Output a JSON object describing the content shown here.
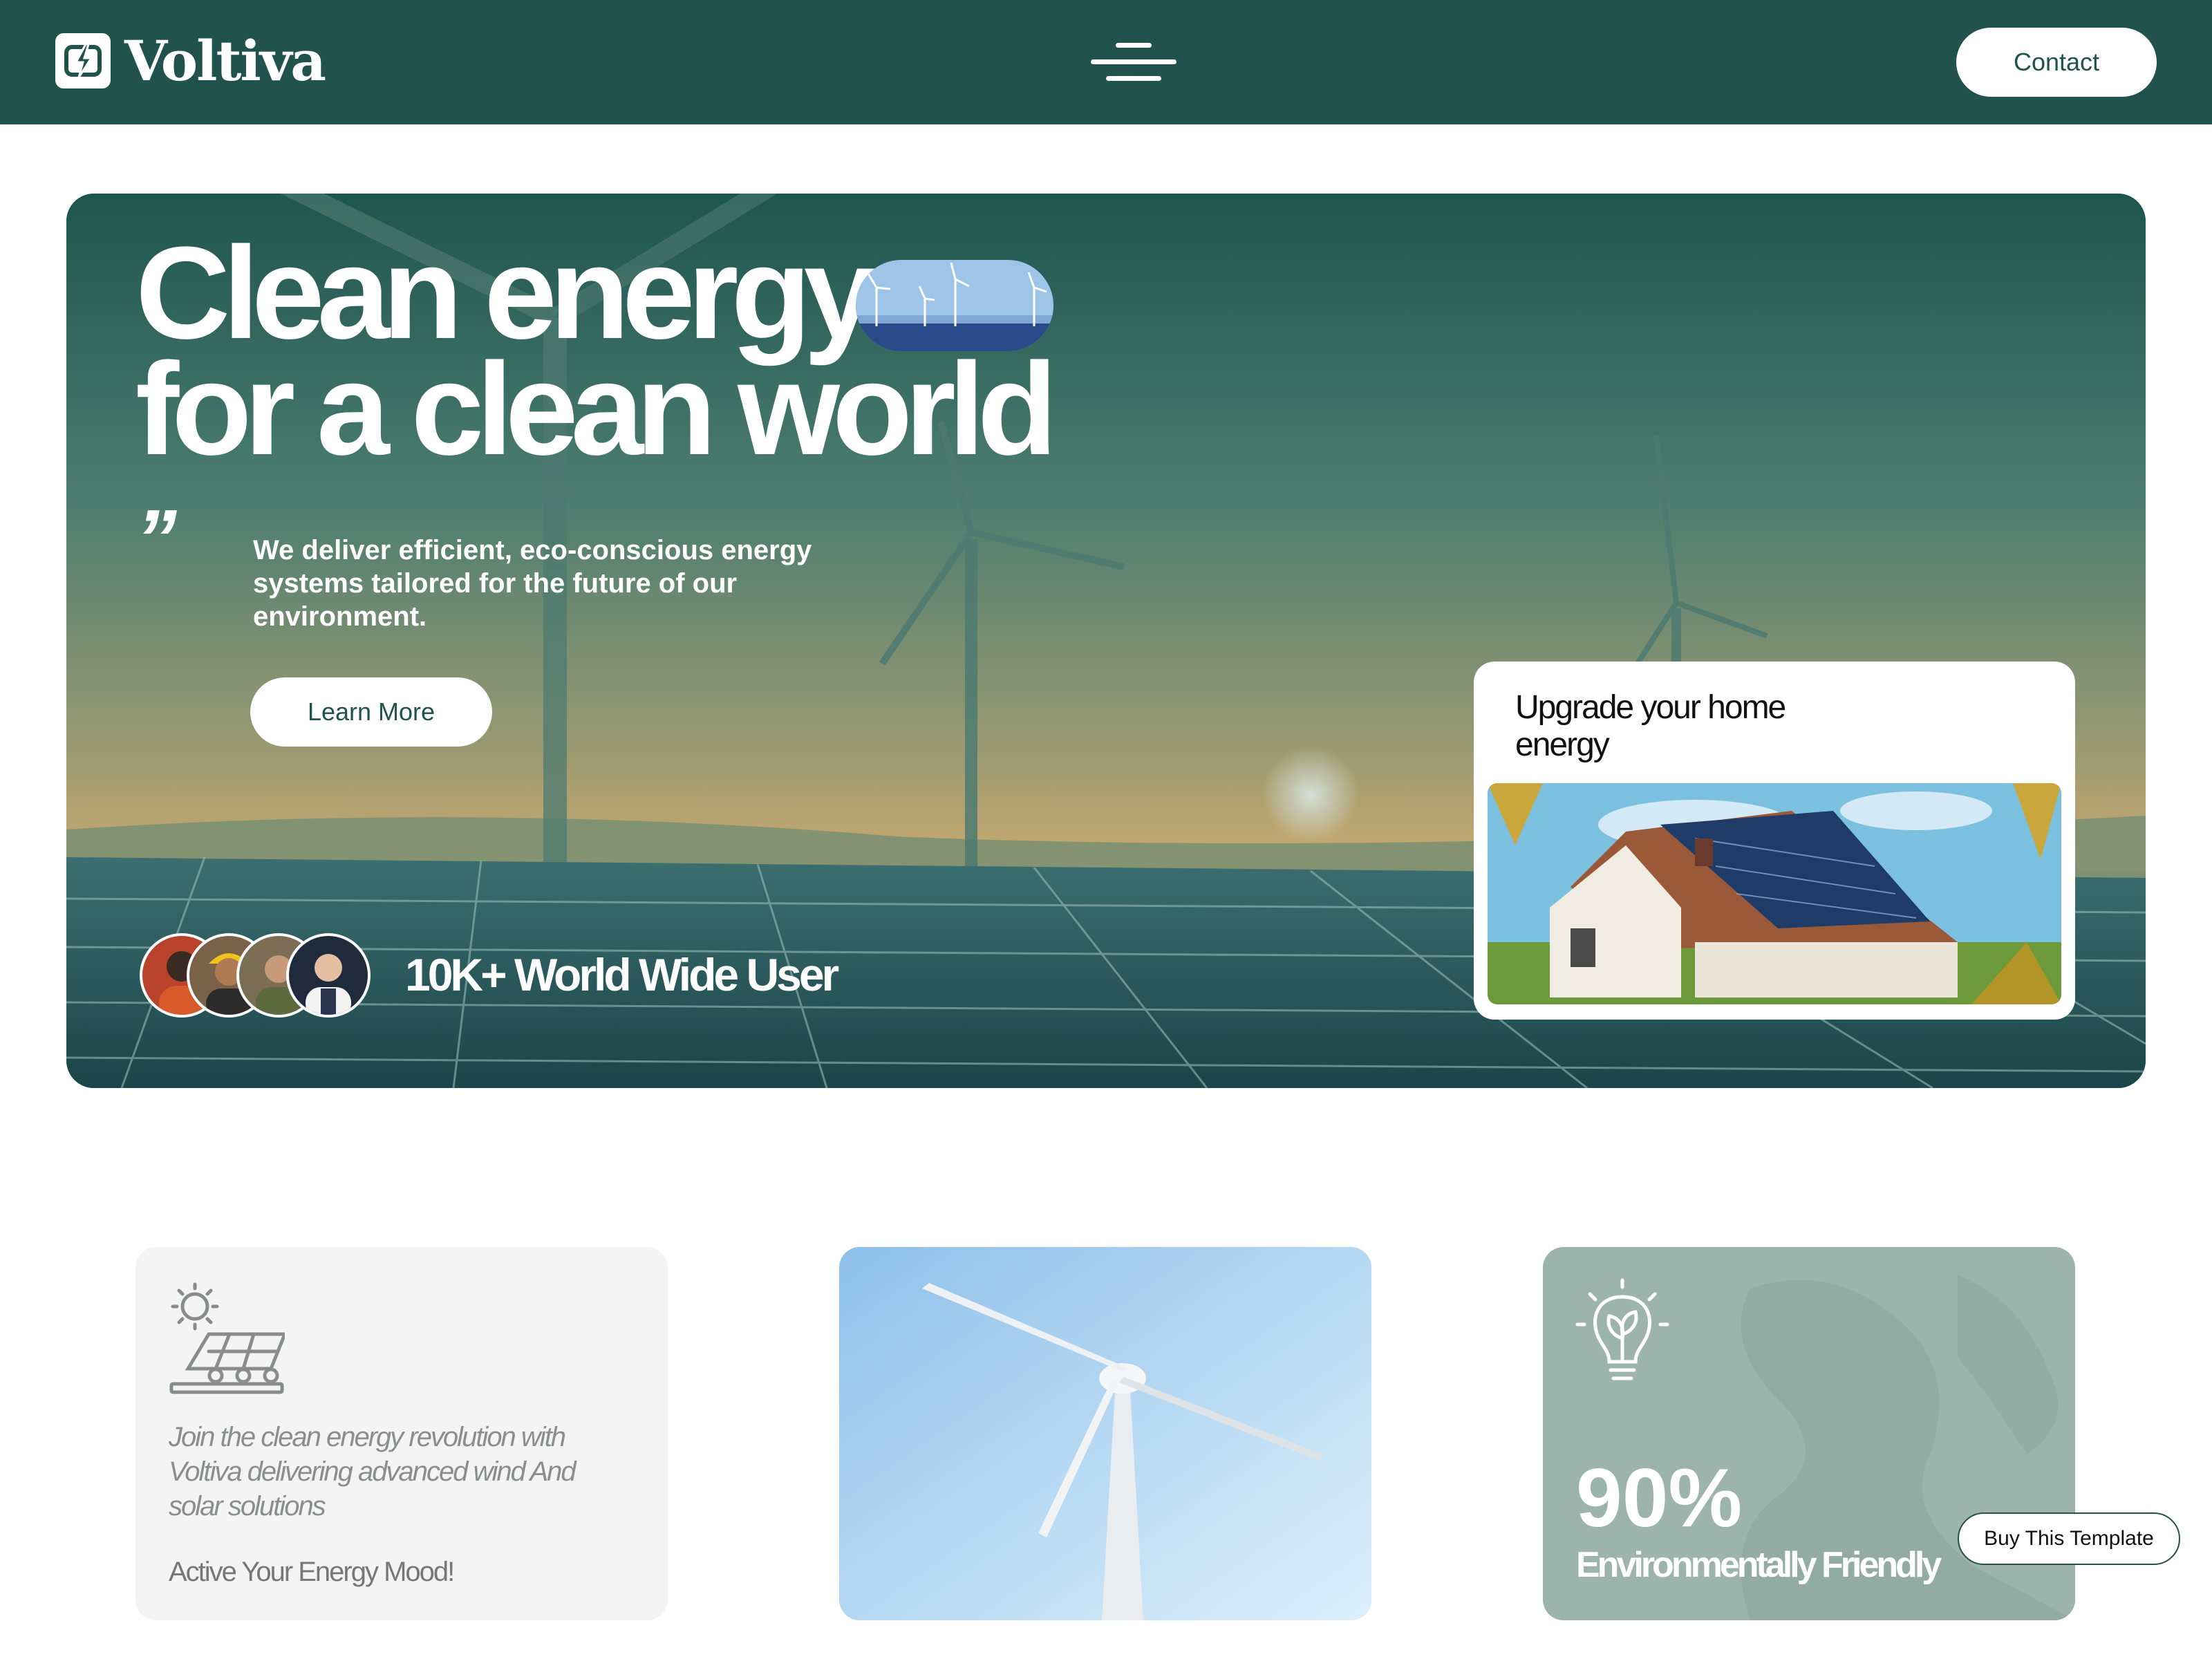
{
  "header": {
    "brand": "Voltiva",
    "contact_label": "Contact"
  },
  "hero": {
    "title_line1": "Clean energy",
    "title_line2": "for a clean world",
    "quote_mark": "”",
    "description": "We deliver efficient, eco-conscious energy systems tailored for the future of our environment.",
    "cta_label": "Learn More",
    "users_text": "10K+ World Wide User",
    "upgrade_card_title": "Upgrade your home energy"
  },
  "features": {
    "card1_text": "Join the clean energy revolution with Voltiva delivering advanced wind And solar solutions",
    "card1_cta": "Active Your Energy Mood!",
    "card3_percent": "90%",
    "card3_label": "Environmentally Friendly"
  },
  "floating": {
    "buy_label": "Buy This Template"
  },
  "colors": {
    "brand_dark_green": "#21524d",
    "white": "#ffffff",
    "card_gray": "#f3f4f3",
    "card_sky": "#a6d0ef",
    "card_sage": "#9cb4ac"
  },
  "icons": [
    "lightning-logo-icon",
    "hamburger-menu-icon",
    "sun-solar-panel-icon",
    "lightbulb-leaf-icon"
  ]
}
